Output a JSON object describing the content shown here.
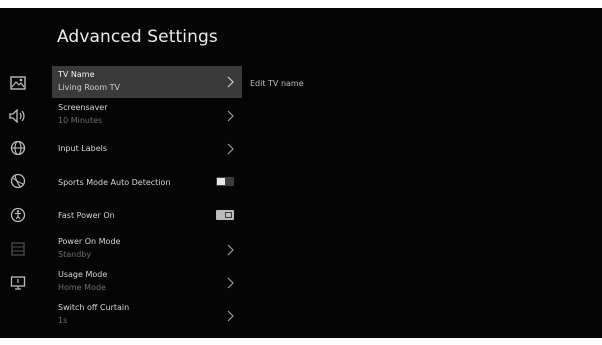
{
  "page": {
    "title": "Advanced Settings",
    "detail_text": "Edit TV name"
  },
  "rail_icons": [
    "picture-icon",
    "sound-icon",
    "network-icon",
    "sports-icon",
    "accessibility-icon",
    "system-icon",
    "display-icon"
  ],
  "menu": [
    {
      "label": "TV Name",
      "sub": "Living Room TV",
      "control": "chevron",
      "selected": true
    },
    {
      "label": "Screensaver",
      "sub": "10 Minutes",
      "control": "chevron",
      "selected": false
    },
    {
      "label": "Input Labels",
      "sub": "",
      "control": "chevron",
      "selected": false
    },
    {
      "label": "Sports Mode Auto Detection",
      "sub": "",
      "control": "toggle",
      "state": "off",
      "selected": false
    },
    {
      "label": "Fast Power On",
      "sub": "",
      "control": "checkbox",
      "state": "on",
      "selected": false
    },
    {
      "label": "Power On Mode",
      "sub": "Standby",
      "control": "chevron",
      "selected": false
    },
    {
      "label": "Usage Mode",
      "sub": "Home Mode",
      "control": "chevron",
      "selected": false
    },
    {
      "label": "Switch off Curtain",
      "sub": "1s",
      "control": "chevron",
      "selected": false
    }
  ],
  "colors": {
    "background": "#050505",
    "selected_row": "#3a3a3a",
    "text": "#d4d4d4",
    "subtext": "#6d6d6d"
  }
}
